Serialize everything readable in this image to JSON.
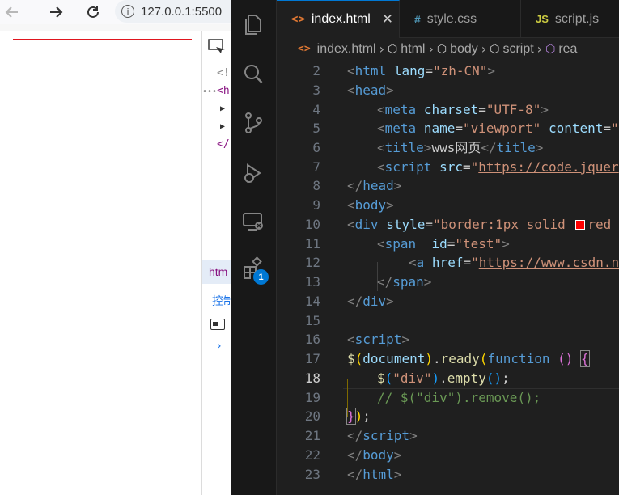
{
  "browser": {
    "url": "127.0.0.1:5500",
    "info_glyph": "i",
    "nav_back_icon": "arrow-left-icon",
    "nav_forward_icon": "arrow-right-icon",
    "nav_refresh_icon": "refresh-icon"
  },
  "devtools": {
    "lines": [
      "<!",
      "<h",
      "▶",
      "▶",
      "</"
    ],
    "html_tab_label": "htm",
    "console_label": "控制",
    "prompt": "›"
  },
  "colors": {
    "accent": "#0078d4",
    "red_border": "#e0161f",
    "editor_bg": "#1f1f1f",
    "tag": "#569cd6",
    "attribute": "#9cdcfe",
    "string": "#ce9178",
    "function": "#dcdcaa",
    "comment": "#6a9955"
  },
  "activity_bar": {
    "icons": [
      "files-icon",
      "search-icon",
      "source-control-icon",
      "run-debug-icon",
      "remote-explorer-icon",
      "extensions-icon"
    ],
    "badge_count": "1"
  },
  "tabs": [
    {
      "label": "index.html",
      "icon": "<>",
      "active": true
    },
    {
      "label": "style.css",
      "icon": "#",
      "active": false
    },
    {
      "label": "script.js",
      "icon": "JS",
      "active": false
    }
  ],
  "tab_close_glyph": "✕",
  "breadcrumb": {
    "items": [
      "index.html",
      "html",
      "body",
      "script",
      "rea"
    ]
  },
  "editor": {
    "active_line": 18,
    "line_numbers": [
      "2",
      "3",
      "4",
      "5",
      "6",
      "7",
      "8",
      "9",
      "10",
      "11",
      "12",
      "13",
      "14",
      "15",
      "16",
      "17",
      "18",
      "19",
      "20",
      "21",
      "22",
      "23"
    ],
    "code": {
      "l2_open": "<",
      "l2_tag": "html",
      "l2_attr": "lang",
      "l2_val": "\"zh-CN\"",
      "l2_close": ">",
      "l3_open": "<",
      "l3_tag": "head",
      "l3_close": ">",
      "l4_tag": "meta",
      "l4_attr": "charset",
      "l4_val": "\"UTF-8\"",
      "l5_tag": "meta",
      "l5_attr1": "name",
      "l5_val1": "\"viewport\"",
      "l5_attr2": "content",
      "l5_val2": "\"",
      "l6_tag": "title",
      "l6_text": "wws网页",
      "l6_endtag": "title",
      "l7_tag": "script",
      "l7_attr": "src",
      "l7_q": "\"",
      "l7_url": "https://code.jquer",
      "l8_tag": "head",
      "l9_tag": "body",
      "l10_tag": "div",
      "l10_attr": "style",
      "l10_val1": "\"border:1px solid ",
      "l10_val2": "red",
      "l11_tag": "span",
      "l11_attr": "id",
      "l11_val": "\"test\"",
      "l12_tag": "a",
      "l12_attr": "href",
      "l12_q": "\"",
      "l12_url": "https://www.csdn.n",
      "l13_tag": "span",
      "l14_tag": "div",
      "l16_tag": "script",
      "l17_dollar": "$",
      "l17_arg": "document",
      "l17_method": "ready",
      "l17_kw": "function",
      "l17_parens": "()",
      "l18_dollar": "$",
      "l18_arg": "\"div\"",
      "l18_method": "empty",
      "l18_end": ";",
      "l19_comment": "// $(\"div\").remove();",
      "l20_end": ";",
      "l21_tag": "script",
      "l22_tag": "body",
      "l23_tag": "html"
    }
  }
}
